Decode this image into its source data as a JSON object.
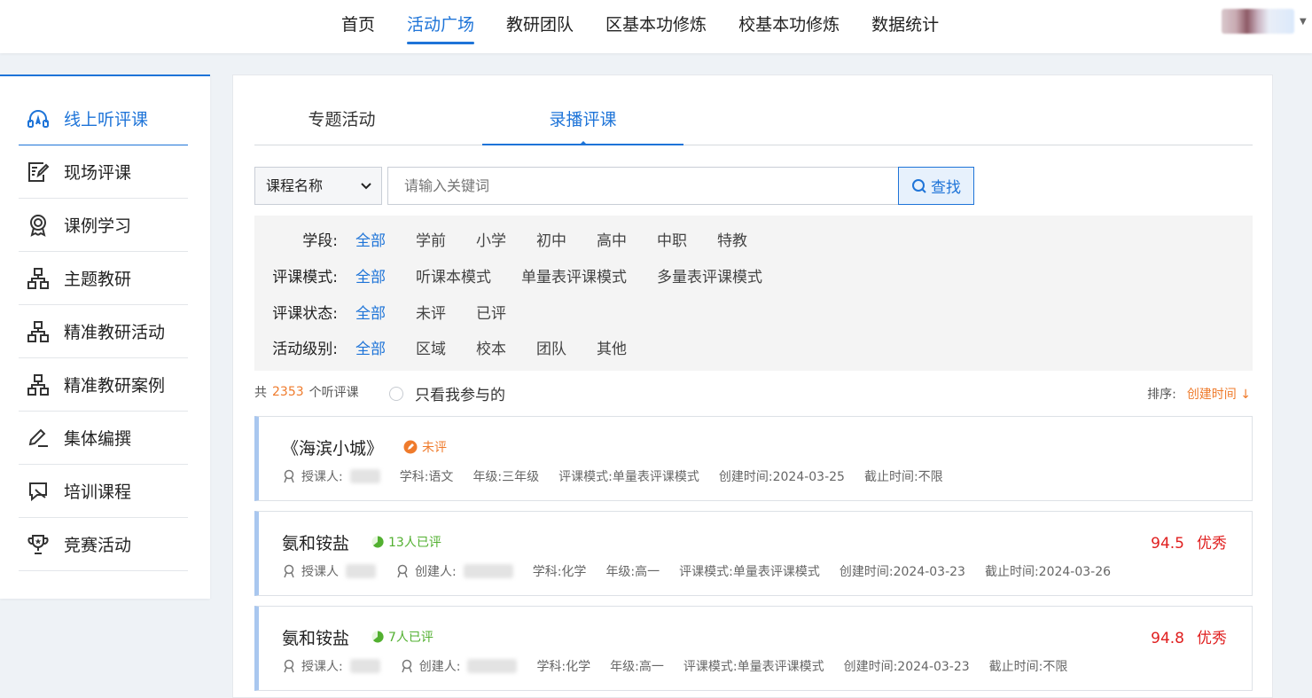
{
  "nav": {
    "items": [
      {
        "label": "首页",
        "active": false
      },
      {
        "label": "活动广场",
        "active": true
      },
      {
        "label": "教研团队",
        "active": false
      },
      {
        "label": "区基本功修炼",
        "active": false
      },
      {
        "label": "校基本功修炼",
        "active": false
      },
      {
        "label": "数据统计",
        "active": false
      }
    ],
    "user_menu_icon": "chevron-down-icon"
  },
  "sidebar": {
    "items": [
      {
        "label": "线上听评课",
        "icon": "headset-icon",
        "active": true
      },
      {
        "label": "现场评课",
        "icon": "edit-note-icon",
        "active": false
      },
      {
        "label": "课例学习",
        "icon": "award-icon",
        "active": false
      },
      {
        "label": "主题教研",
        "icon": "org-chart-icon",
        "active": false
      },
      {
        "label": "精准教研活动",
        "icon": "org-chart-icon",
        "active": false
      },
      {
        "label": "精准教研案例",
        "icon": "org-chart-icon",
        "active": false
      },
      {
        "label": "集体编撰",
        "icon": "pen-icon",
        "active": false
      },
      {
        "label": "培训课程",
        "icon": "chat-check-icon",
        "active": false
      },
      {
        "label": "竞赛活动",
        "icon": "trophy-icon",
        "active": false
      }
    ]
  },
  "tabs": [
    {
      "label": "专题活动",
      "active": false
    },
    {
      "label": "录播评课",
      "active": true
    }
  ],
  "search": {
    "select_value": "课程名称",
    "placeholder": "请输入关键词",
    "button_label": "查找"
  },
  "filters": [
    {
      "label": "学段:",
      "options": [
        "全部",
        "学前",
        "小学",
        "初中",
        "高中",
        "中职",
        "特教"
      ],
      "active_index": 0
    },
    {
      "label": "评课模式:",
      "options": [
        "全部",
        "听课本模式",
        "单量表评课模式",
        "多量表评课模式"
      ],
      "active_index": 0
    },
    {
      "label": "评课状态:",
      "options": [
        "全部",
        "未评",
        "已评"
      ],
      "active_index": 0
    },
    {
      "label": "活动级别:",
      "options": [
        "全部",
        "区域",
        "校本",
        "团队",
        "其他"
      ],
      "active_index": 0
    }
  ],
  "summary": {
    "prefix": "共",
    "count": "2353",
    "suffix": "个听评课",
    "only_mine_label": "只看我参与的",
    "sort_label": "排序:",
    "sort_value": "创建时间 ↓"
  },
  "cards": [
    {
      "title": "《海滨小城》",
      "status": "未评",
      "status_color": "#ef7b2c",
      "teacher_label": "授课人:",
      "subject": "学科:语文",
      "grade": "年级:三年级",
      "mode": "评课模式:单量表评课模式",
      "created": "创建时间:2024-03-25",
      "deadline": "截止时间:不限"
    },
    {
      "title": "氨和铵盐",
      "status": "13人已评",
      "status_color": "#52b030",
      "teacher_label": "授课人",
      "creator_label": "创建人:",
      "subject": "学科:化学",
      "grade": "年级:高一",
      "mode": "评课模式:单量表评课模式",
      "created": "创建时间:2024-03-23",
      "deadline": "截止时间:2024-03-26",
      "score": "94.5",
      "rating": "优秀"
    },
    {
      "title": "氨和铵盐",
      "status": "7人已评",
      "status_color": "#52b030",
      "teacher_label": "授课人:",
      "creator_label": "创建人:",
      "subject": "学科:化学",
      "grade": "年级:高一",
      "mode": "评课模式:单量表评课模式",
      "created": "创建时间:2024-03-23",
      "deadline": "截止时间:不限",
      "score": "94.8",
      "rating": "优秀"
    }
  ],
  "colors": {
    "accent": "#1e74d8",
    "orange": "#ef7b2c",
    "green": "#52b030",
    "red": "#e02020"
  }
}
